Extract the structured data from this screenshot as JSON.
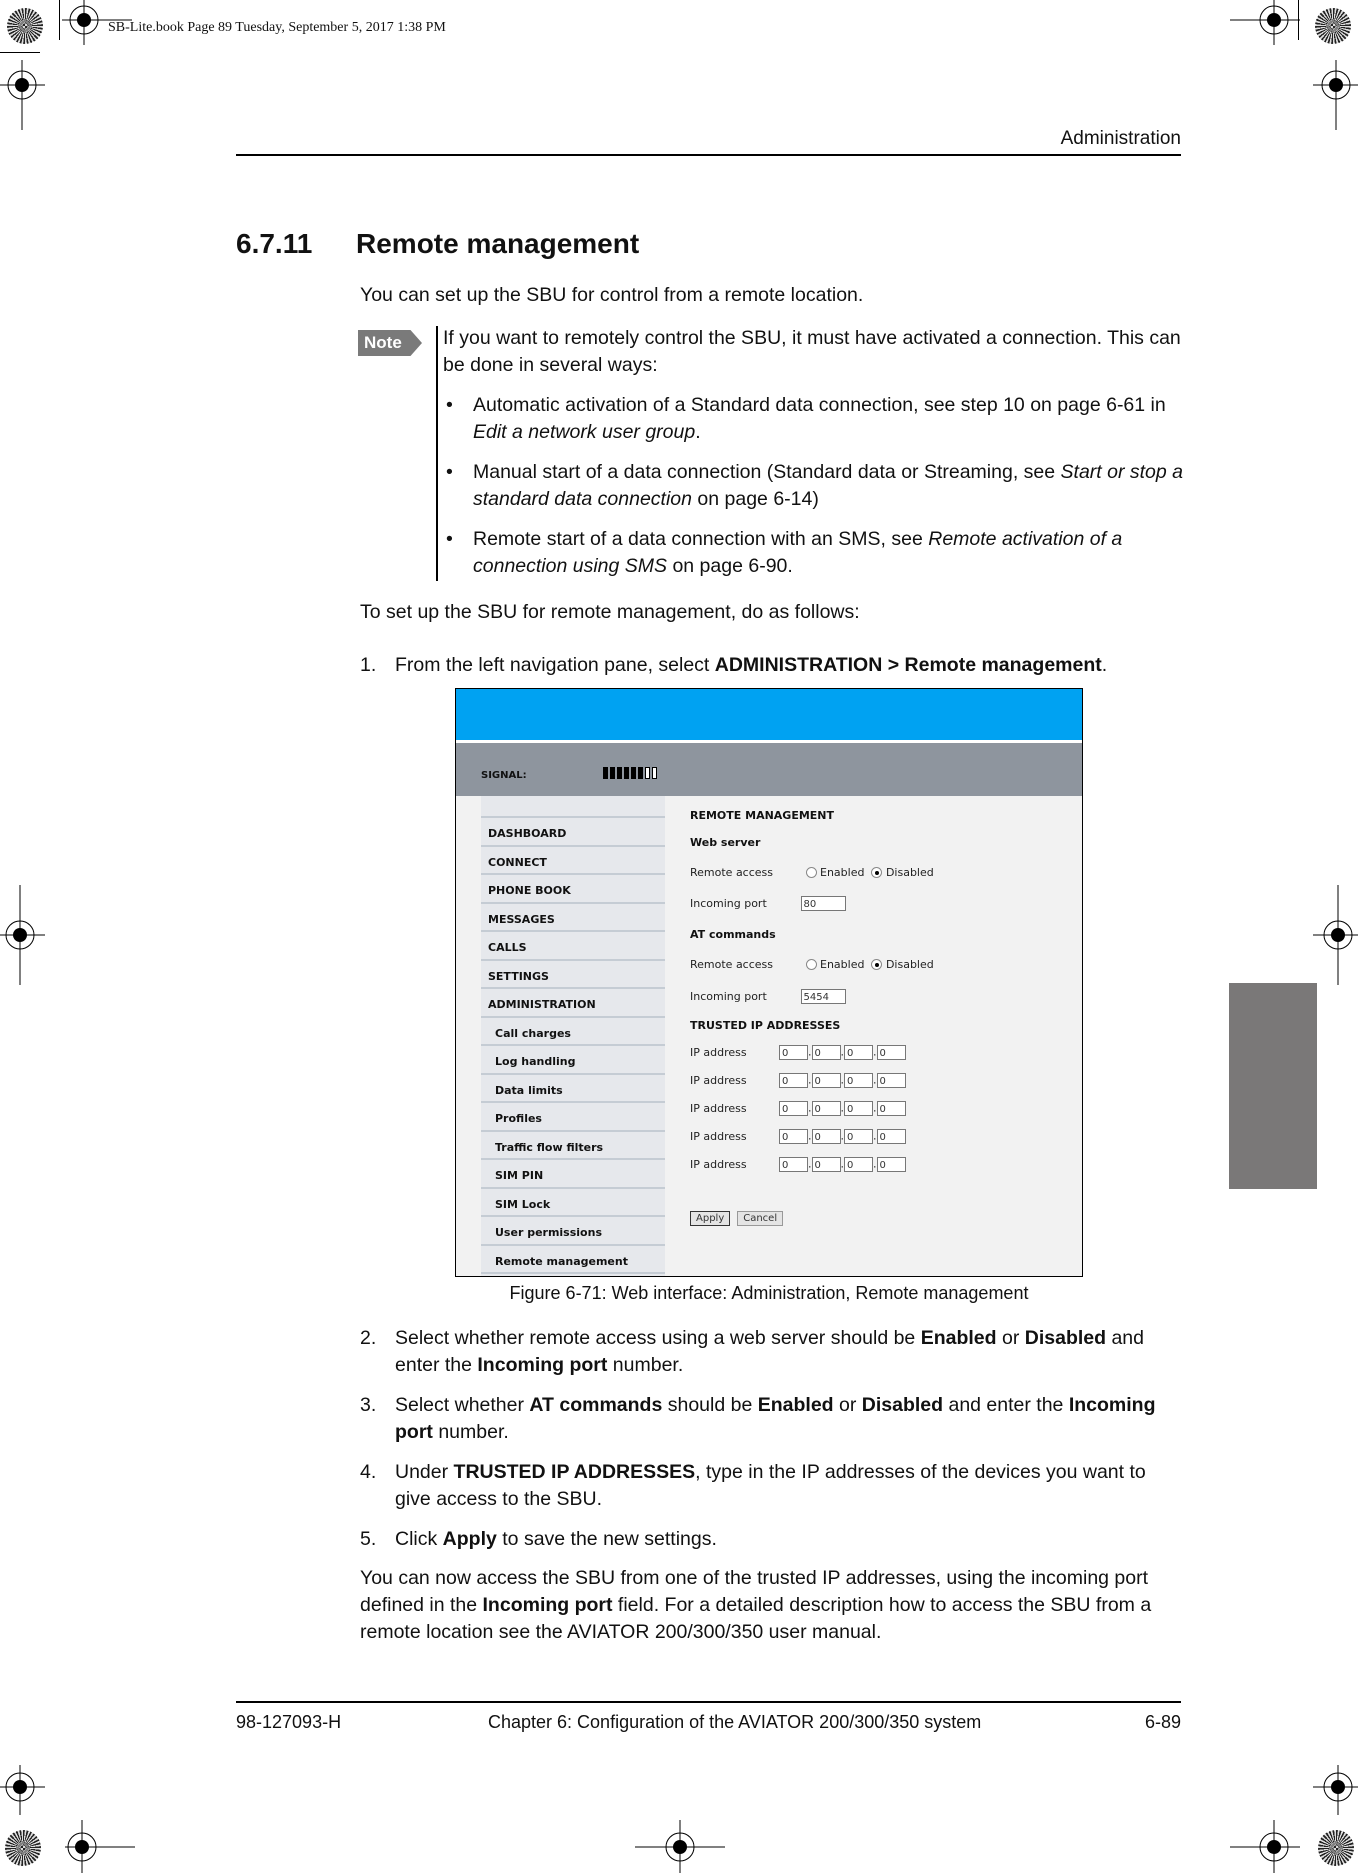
{
  "print_slug": "SB-Lite.book  Page 89  Tuesday, September 5, 2017  1:38 PM",
  "header": {
    "section": "Administration"
  },
  "heading": {
    "number": "6.7.11",
    "title": "Remote management"
  },
  "intro": "You can set up the SBU for control from a remote location.",
  "note": {
    "label": "Note",
    "text": "If you want to remotely control the SBU, it must have activated a connection. This can be done in several ways:",
    "bullets": [
      {
        "pre": "Automatic activation of a Standard data connection, see step 10 on page 6-61 in ",
        "em": "Edit a network user group",
        "post": "."
      },
      {
        "pre": "Manual start of a data connection (Standard data or Streaming, see ",
        "em": "Start or stop a standard data connection",
        "post": " on page 6-14)"
      },
      {
        "pre": "Remote start of a data connection with an SMS, see ",
        "em": "Remote activation of a connection using SMS",
        "post": " on page 6-90."
      }
    ]
  },
  "lead_in": "To set up the SBU for remote management, do as follows:",
  "step1": {
    "n": "1.",
    "pre": "From the left navigation pane, select ",
    "bold": "ADMINISTRATION > Remote management",
    "post": "."
  },
  "figure": {
    "caption": "Figure 6-71: Web interface: Administration, Remote management",
    "signal_label": "SIGNAL:",
    "signal_level": 6,
    "signal_max": 8,
    "nav": [
      {
        "label": "DASHBOARD",
        "sub": false
      },
      {
        "label": "CONNECT",
        "sub": false
      },
      {
        "label": "PHONE BOOK",
        "sub": false
      },
      {
        "label": "MESSAGES",
        "sub": false
      },
      {
        "label": "CALLS",
        "sub": false
      },
      {
        "label": "SETTINGS",
        "sub": false
      },
      {
        "label": "ADMINISTRATION",
        "sub": false
      },
      {
        "label": "Call charges",
        "sub": true
      },
      {
        "label": "Log handling",
        "sub": true
      },
      {
        "label": "Data limits",
        "sub": true
      },
      {
        "label": "Profiles",
        "sub": true
      },
      {
        "label": "Traffic flow filters",
        "sub": true
      },
      {
        "label": "SIM PIN",
        "sub": true
      },
      {
        "label": "SIM Lock",
        "sub": true
      },
      {
        "label": "User permissions",
        "sub": true
      },
      {
        "label": "Remote management",
        "sub": true
      }
    ],
    "form": {
      "title": "REMOTE MANAGEMENT",
      "web_server": {
        "heading": "Web server",
        "remote_access_label": "Remote access",
        "enabled_label": "Enabled",
        "disabled_label": "Disabled",
        "selected": "Disabled",
        "port_label": "Incoming port",
        "port_value": "80"
      },
      "at_commands": {
        "heading": "AT commands",
        "remote_access_label": "Remote access",
        "enabled_label": "Enabled",
        "disabled_label": "Disabled",
        "selected": "Disabled",
        "port_label": "Incoming port",
        "port_value": "5454"
      },
      "trusted_heading": "TRUSTED IP ADDRESSES",
      "ip_label": "IP address",
      "ip_rows": [
        [
          "0",
          "0",
          "0",
          "0"
        ],
        [
          "0",
          "0",
          "0",
          "0"
        ],
        [
          "0",
          "0",
          "0",
          "0"
        ],
        [
          "0",
          "0",
          "0",
          "0"
        ],
        [
          "0",
          "0",
          "0",
          "0"
        ]
      ],
      "apply_label": "Apply",
      "cancel_label": "Cancel"
    }
  },
  "steps": [
    {
      "n": "2.",
      "parts": [
        [
          "t",
          "Select whether remote access using a web server should be "
        ],
        [
          "b",
          "Enabled"
        ],
        [
          "t",
          " or "
        ],
        [
          "b",
          "Disabled"
        ],
        [
          "t",
          " and enter the "
        ],
        [
          "b",
          "Incoming port"
        ],
        [
          "t",
          " number."
        ]
      ]
    },
    {
      "n": "3.",
      "parts": [
        [
          "t",
          "Select whether "
        ],
        [
          "b",
          "AT commands"
        ],
        [
          "t",
          " should be "
        ],
        [
          "b",
          "Enabled"
        ],
        [
          "t",
          " or "
        ],
        [
          "b",
          "Disabled"
        ],
        [
          "t",
          " and enter the "
        ],
        [
          "b",
          "Incoming port"
        ],
        [
          "t",
          " number."
        ]
      ]
    },
    {
      "n": "4.",
      "parts": [
        [
          "t",
          "Under "
        ],
        [
          "b",
          "TRUSTED IP ADDRESSES"
        ],
        [
          "t",
          ", type in the IP addresses of the devices you want to give access to the SBU."
        ]
      ]
    },
    {
      "n": "5.",
      "parts": [
        [
          "t",
          "Click "
        ],
        [
          "b",
          "Apply"
        ],
        [
          "t",
          " to save the new settings."
        ]
      ]
    }
  ],
  "closing": [
    [
      "t",
      "You can now access the SBU from one of the trusted IP addresses, using the incoming port defined in the "
    ],
    [
      "b",
      "Incoming port"
    ],
    [
      "t",
      " field. For a detailed description how to access the SBU from a remote location see the AVIATOR 200/300/350 user manual."
    ]
  ],
  "footer": {
    "doc_number": "98-127093-H",
    "chapter": "Chapter 6:  Configuration of the AVIATOR 200/300/350 system",
    "page": "6-89"
  }
}
